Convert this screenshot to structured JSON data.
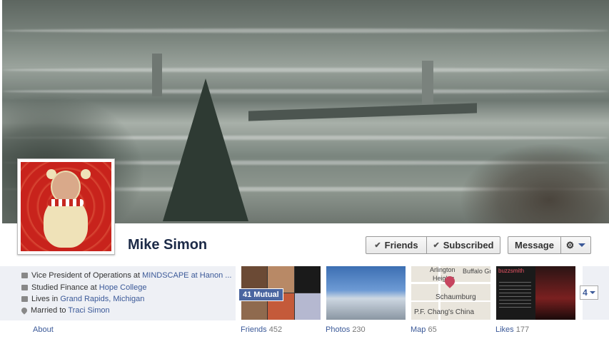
{
  "profile": {
    "name": "Mike Simon"
  },
  "actions": {
    "friends_label": "Friends",
    "subscribed_label": "Subscribed",
    "message_label": "Message",
    "gear_icon": "gear-icon"
  },
  "about": {
    "label": "About",
    "work_prefix": "Vice President of Operations at ",
    "work_link": "MINDSCAPE at Hanon ...",
    "study_prefix": "Studied Finance at ",
    "study_link": "Hope College",
    "lives_prefix": "Lives in ",
    "lives_link": "Grand Rapids, Michigan",
    "married_prefix": "Married to ",
    "married_link": "Traci Simon"
  },
  "tiles": {
    "mutual_badge": "41 Mutual",
    "friends_label": "Friends",
    "friends_count": "452",
    "photos_label": "Photos",
    "photos_count": "230",
    "map_label": "Map",
    "map_count": "65",
    "likes_label": "Likes",
    "likes_count": "177",
    "more_count": "4",
    "map_text": {
      "arlington": "Arlington",
      "heights": "Heights",
      "buffalo": "Buffalo Gr",
      "schaumburg": "Schaumburg",
      "pf": "P.F. Chang's China"
    },
    "likes_brand": "buzzsmith"
  },
  "colors": {
    "link": "#3b5998",
    "name": "#1c2a47",
    "panel": "#eef0f5"
  }
}
